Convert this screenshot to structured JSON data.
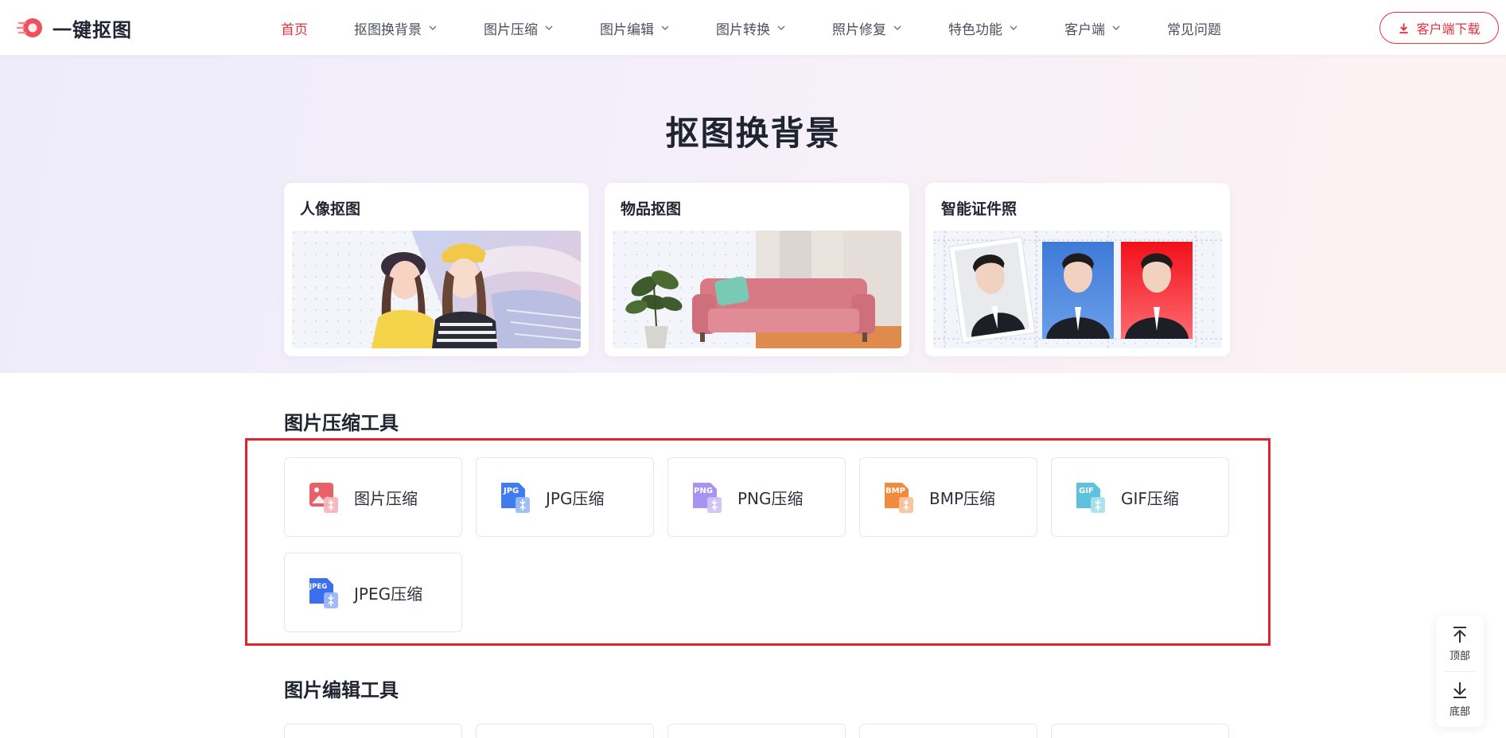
{
  "brand": {
    "name": "一键抠图",
    "accent": "#e9303f"
  },
  "nav": {
    "items": [
      {
        "label": "首页",
        "active": true,
        "dropdown": false
      },
      {
        "label": "抠图换背景",
        "active": false,
        "dropdown": true
      },
      {
        "label": "图片压缩",
        "active": false,
        "dropdown": true
      },
      {
        "label": "图片编辑",
        "active": false,
        "dropdown": true
      },
      {
        "label": "图片转换",
        "active": false,
        "dropdown": true
      },
      {
        "label": "照片修复",
        "active": false,
        "dropdown": true
      },
      {
        "label": "特色功能",
        "active": false,
        "dropdown": true
      },
      {
        "label": "客户端",
        "active": false,
        "dropdown": true
      },
      {
        "label": "常见问题",
        "active": false,
        "dropdown": false
      }
    ],
    "download_label": "客户端下载",
    "download_icon": "download-icon"
  },
  "hero": {
    "title": "抠图换背景",
    "cards": [
      {
        "title": "人像抠图",
        "image": "portrait-cutout-illustration"
      },
      {
        "title": "物品抠图",
        "image": "object-cutout-illustration"
      },
      {
        "title": "智能证件照",
        "image": "id-photo-illustration"
      }
    ]
  },
  "compress_section": {
    "title": "图片压缩工具",
    "tools": [
      {
        "label": "图片压缩",
        "icon": "image-compress-icon",
        "color": "#e86168"
      },
      {
        "label": "JPG压缩",
        "icon": "jpg-file-icon",
        "color": "#3f7cf0"
      },
      {
        "label": "PNG压缩",
        "icon": "png-file-icon",
        "color": "#9f8cf0"
      },
      {
        "label": "BMP压缩",
        "icon": "bmp-file-icon",
        "color": "#f08a3c"
      },
      {
        "label": "GIF压缩",
        "icon": "gif-file-icon",
        "color": "#5ec2dc"
      },
      {
        "label": "JPEG压缩",
        "icon": "jpeg-file-icon",
        "color": "#3b6ff0"
      }
    ]
  },
  "edit_section": {
    "title": "图片编辑工具"
  },
  "float_panel": {
    "top_label": "顶部",
    "bottom_label": "底部"
  }
}
